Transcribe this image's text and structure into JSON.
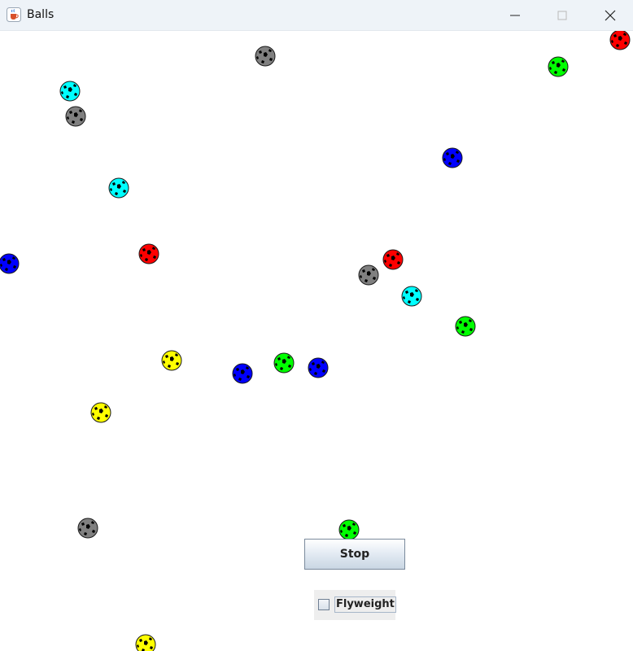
{
  "window": {
    "title": "Balls",
    "icon": "java-coffee-cup-icon",
    "controls": [
      "minimize-icon",
      "maximize-icon",
      "close-icon"
    ]
  },
  "balls": [
    {
      "color": "#808080"
    },
    {
      "color": "#ff0000"
    },
    {
      "color": "#00ff00"
    },
    {
      "color": "#00ffff"
    },
    {
      "color": "#808080"
    },
    {
      "color": "#0000ff"
    },
    {
      "color": "#00ffff"
    },
    {
      "color": "#0000ff"
    },
    {
      "color": "#ff0000"
    },
    {
      "color": "#ff0000"
    },
    {
      "color": "#808080"
    },
    {
      "color": "#00ffff"
    },
    {
      "color": "#00ff00"
    },
    {
      "color": "#ffff00"
    },
    {
      "color": "#00ff00"
    },
    {
      "color": "#0000ff"
    },
    {
      "color": "#0000ff"
    },
    {
      "color": "#ffff00"
    },
    {
      "color": "#808080"
    },
    {
      "color": "#00ff00"
    },
    {
      "color": "#ffff00"
    }
  ],
  "controls": {
    "stop_label": "Stop",
    "flyweight_label": "Flyweight",
    "flyweight_checked": false
  }
}
